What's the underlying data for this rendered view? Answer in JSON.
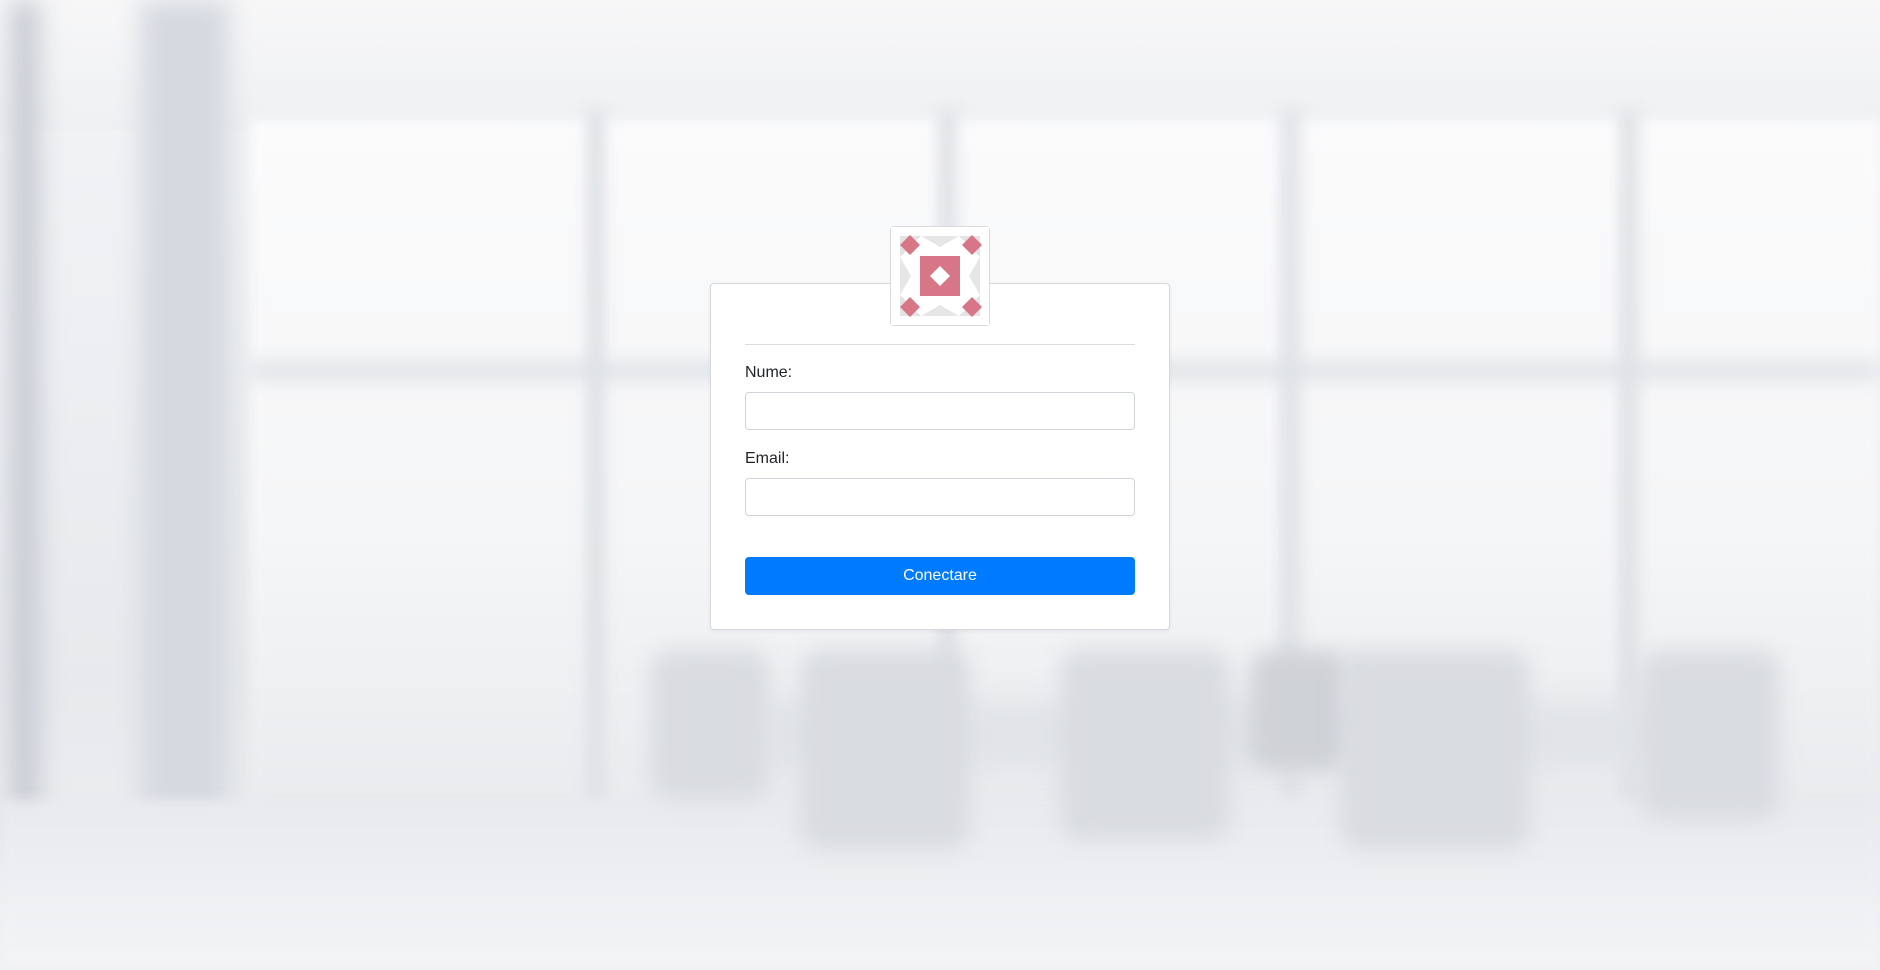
{
  "logo": {
    "icon": "identicon-logo",
    "colors": {
      "primary": "#d67686",
      "secondary": "#e0e0e0",
      "background": "#ffffff"
    }
  },
  "form": {
    "name_label": "Nume:",
    "name_value": "",
    "email_label": "Email:",
    "email_value": "",
    "submit_label": "Conectare"
  },
  "colors": {
    "button": "#007bff",
    "button_text": "#ffffff",
    "card": "#ffffff"
  }
}
